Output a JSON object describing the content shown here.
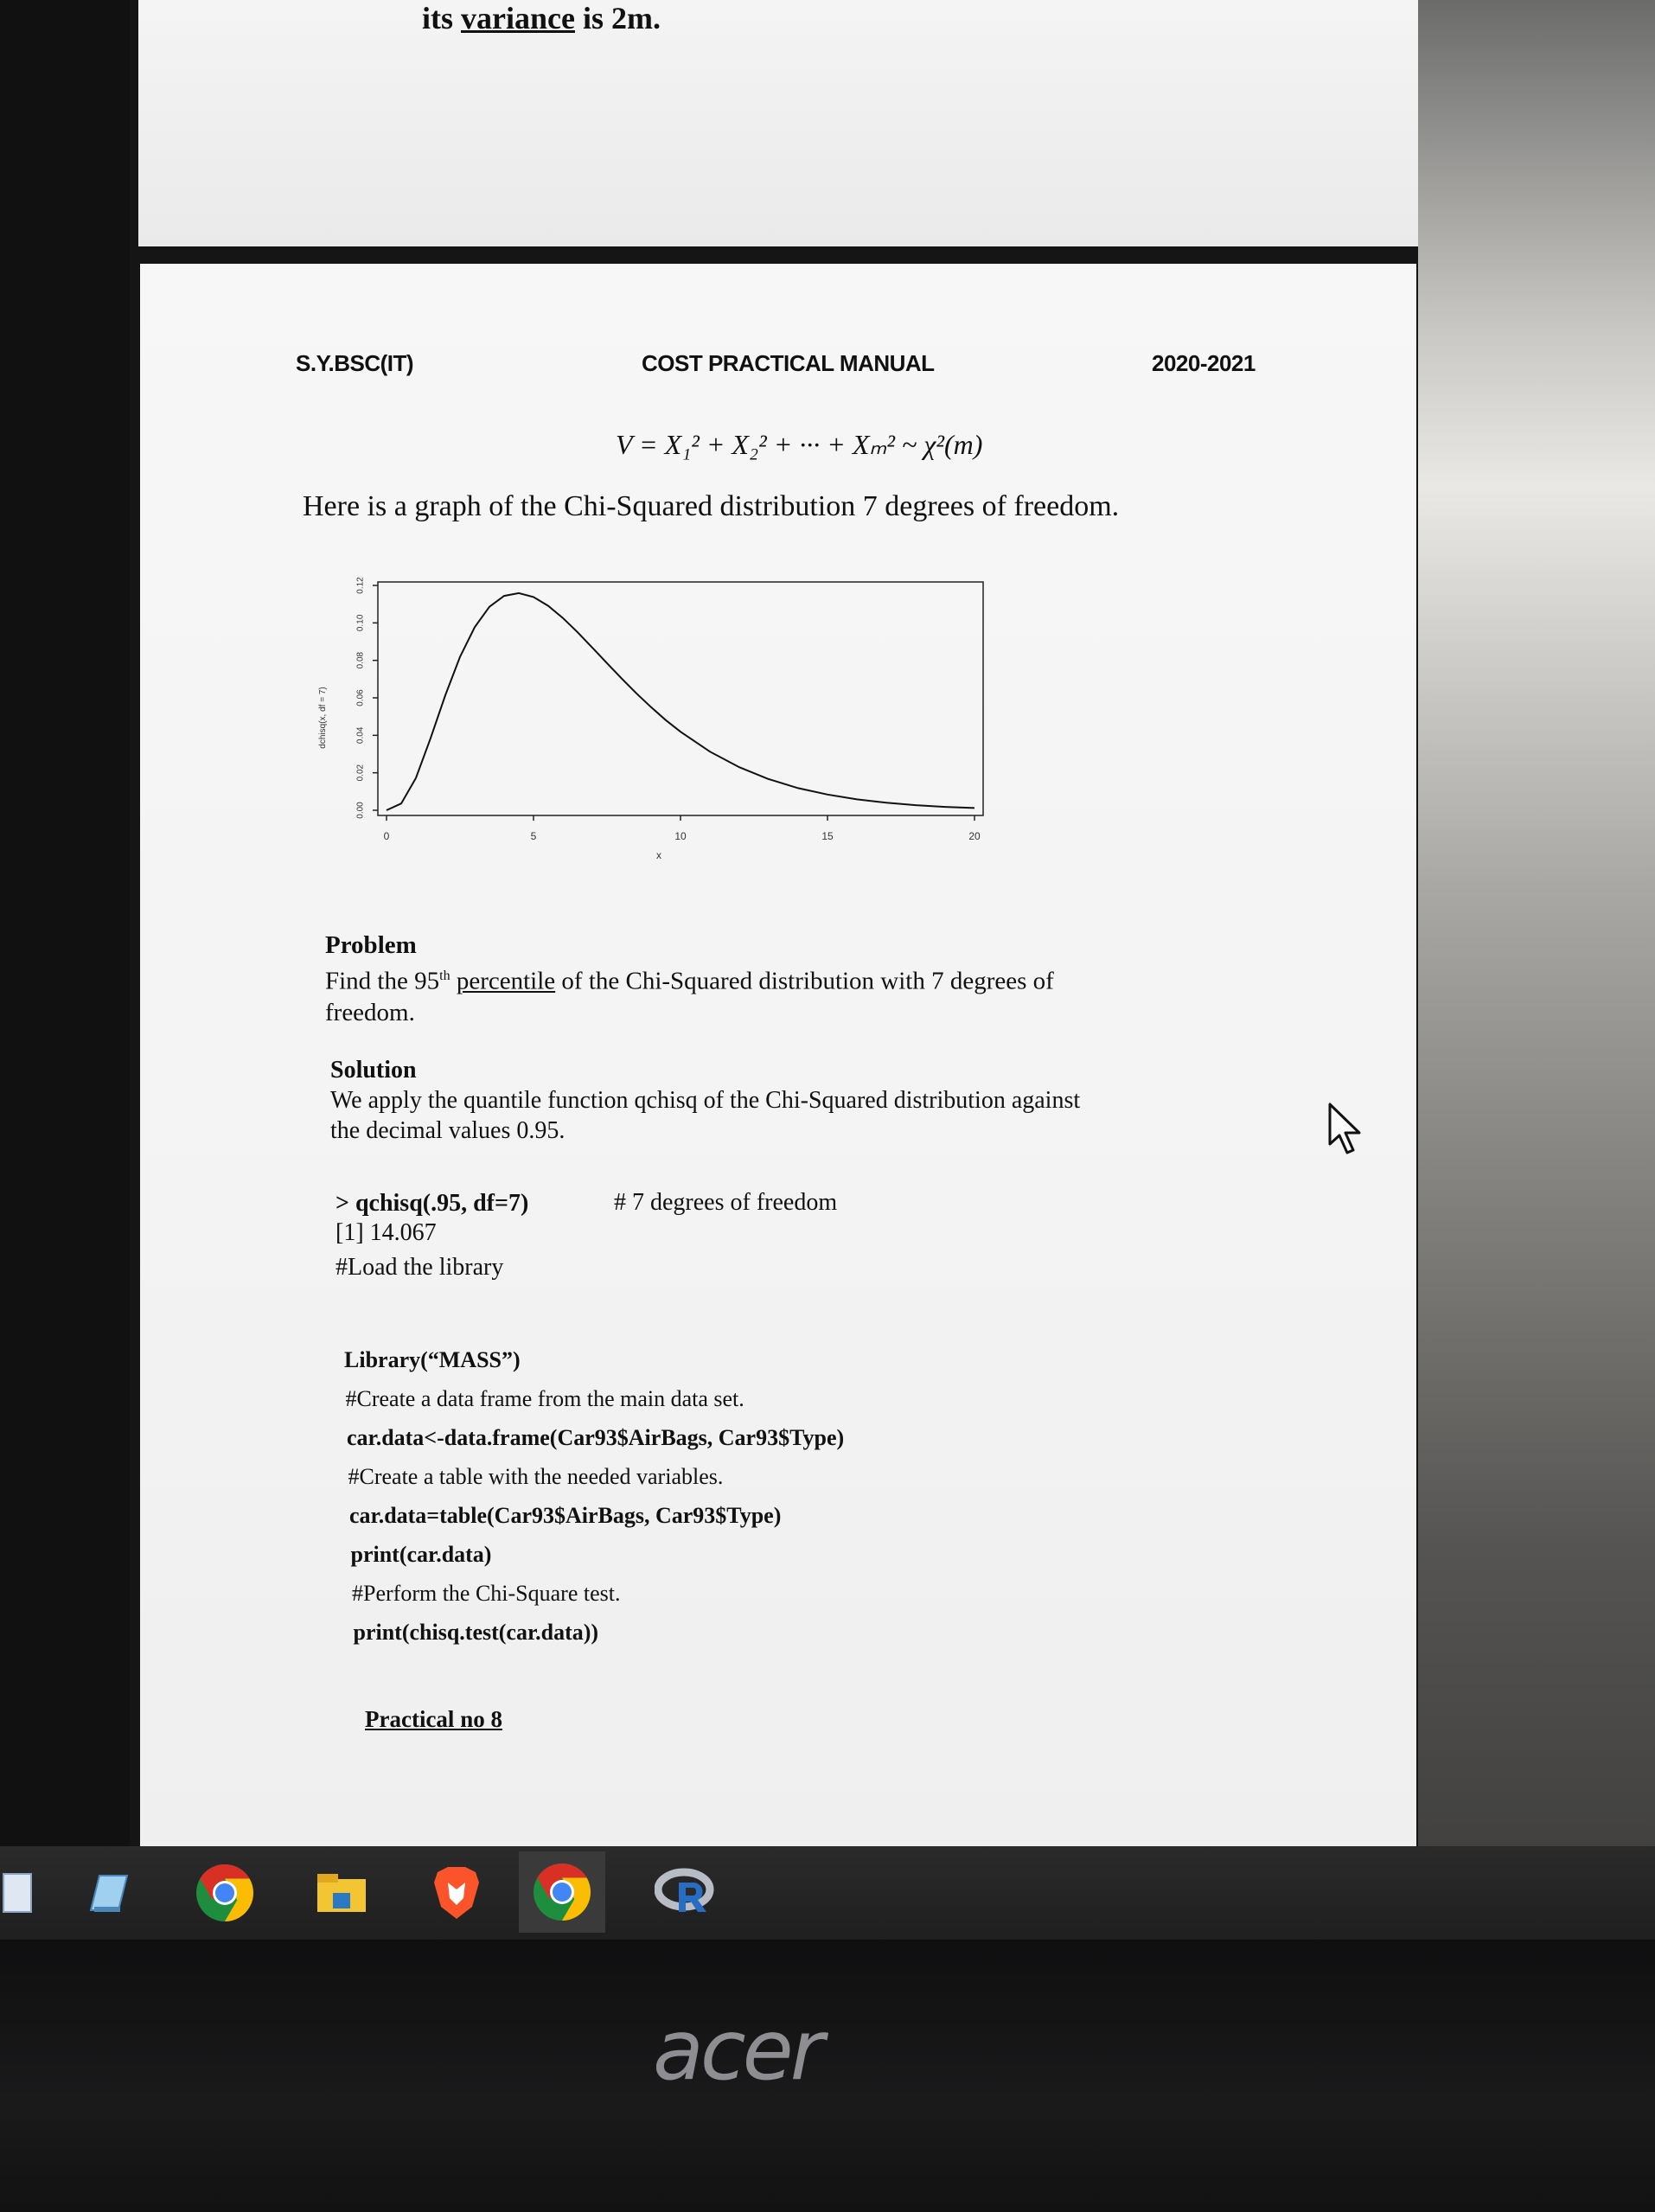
{
  "previous_page": {
    "text_prefix": "its ",
    "text_underlined": "variance",
    "text_suffix": " is 2m."
  },
  "header": {
    "left": "S.Y.BSC(IT)",
    "center": "COST PRACTICAL MANUAL",
    "right": "2020-2021"
  },
  "formula": "V = X₁² + X₂² + ··· + Xₘ² ~ χ²(m)",
  "graph_caption": "Here is a graph of the Chi-Squared distribution 7 degrees of freedom.",
  "chart_data": {
    "type": "line",
    "title": "",
    "xlabel": "x",
    "ylabel": "dchisq(x, df = 7)",
    "x_ticks": [
      "0",
      "5",
      "10",
      "15",
      "20"
    ],
    "y_ticks": [
      "0.00",
      "0.02",
      "0.04",
      "0.06",
      "0.08",
      "0.10",
      "0.12"
    ],
    "xlim": [
      0,
      20
    ],
    "ylim": [
      0,
      0.12
    ],
    "series": [
      {
        "x": [
          0,
          0.5,
          1,
          1.5,
          2,
          2.5,
          3,
          3.5,
          4,
          4.5,
          5,
          5.5,
          6,
          6.5,
          7,
          7.5,
          8,
          8.5,
          9,
          9.5,
          10,
          11,
          12,
          13,
          14,
          15,
          16,
          17,
          18,
          19,
          20
        ],
        "y": [
          0,
          0.0036,
          0.0172,
          0.0385,
          0.0614,
          0.0819,
          0.0977,
          0.1086,
          0.1144,
          0.1159,
          0.1138,
          0.1091,
          0.1026,
          0.095,
          0.0868,
          0.0785,
          0.0703,
          0.0624,
          0.055,
          0.0481,
          0.0419,
          0.0313,
          0.023,
          0.0166,
          0.0118,
          0.0084,
          0.0058,
          0.004,
          0.0027,
          0.0018,
          0.0012
        ]
      }
    ],
    "grid": false
  },
  "problem": {
    "heading": "Problem",
    "line1_a": "Find the 95",
    "line1_sup": "th",
    "line1_b": " ",
    "line1_link": "percentile",
    "line1_c": " of the Chi-Squared distribution with 7 degrees of",
    "line2": "freedom."
  },
  "solution": {
    "heading": "Solution",
    "line1": "We apply the quantile function qchisq of the Chi-Squared distribution against",
    "line2": "the decimal values 0.95."
  },
  "code": {
    "command": "> qchisq(.95, df=7)",
    "comment": "# 7 degrees of freedom",
    "output": "[1] 14.067",
    "load_comment": "#Load the library"
  },
  "library_block": [
    {
      "text": "Library(“MASS”)",
      "bold": true
    },
    {
      "text": "#Create a data frame from the main data set.",
      "bold": false
    },
    {
      "text": "car.data<-data.frame(Car93$AirBags, Car93$Type)",
      "bold": true
    },
    {
      "text": "#Create a table with the needed variables.",
      "bold": false
    },
    {
      "text": "car.data=table(Car93$AirBags, Car93$Type)",
      "bold": true
    },
    {
      "text": "print(car.data)",
      "bold": true
    },
    {
      "text": "#Perform the Chi-Square test.",
      "bold": false
    },
    {
      "text": "print(chisq.test(car.data))",
      "bold": true
    }
  ],
  "practical_link": "Practical no 8",
  "taskbar": {
    "items": [
      "file-icon",
      "notepad-icon",
      "chrome-icon",
      "file-explorer-icon",
      "brave-icon",
      "chrome-icon",
      "r-icon"
    ],
    "active_index": 5
  },
  "monitor_brand": "acer",
  "colors": {
    "page_bg": "#f5f5f5",
    "taskbar_bg": "#262626",
    "chrome_red": "#d93025",
    "chrome_green": "#1e8e3e",
    "chrome_yellow": "#fbbc04",
    "chrome_blue": "#4285f4",
    "brave_orange": "#fb542b",
    "explorer_yellow": "#f3c532",
    "r_blue": "#276dc3"
  }
}
